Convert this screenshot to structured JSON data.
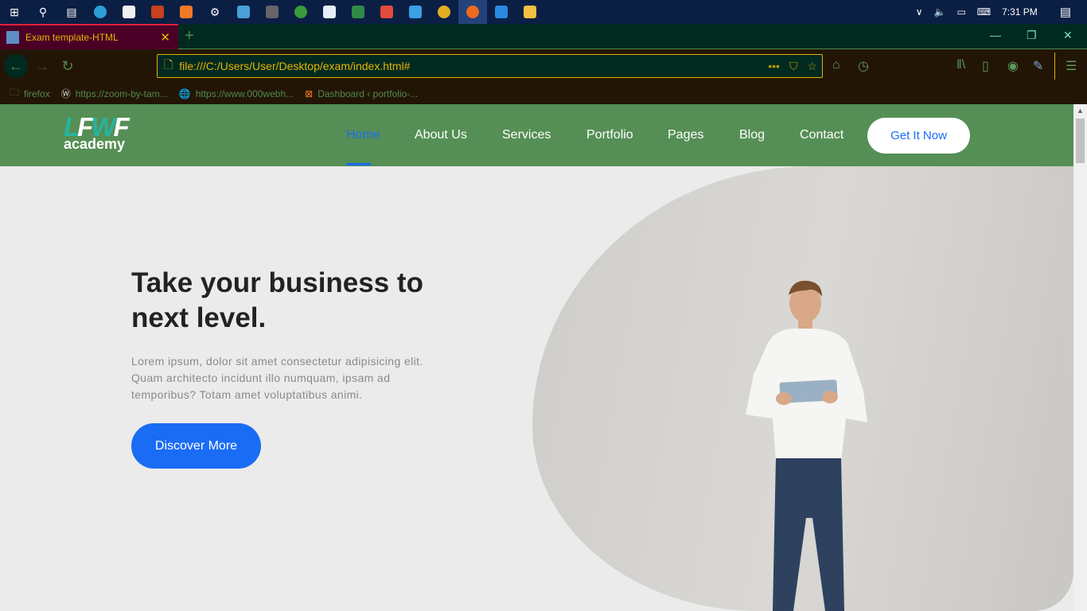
{
  "taskbar": {
    "time": "7:31 PM"
  },
  "browser": {
    "tab_title": "Exam template-HTML",
    "url": "file:///C:/Users/User/Desktop/exam/index.html#",
    "bookmarks": [
      "firefox",
      "https://zoom-by-tam...",
      "https://www.000webh...",
      "Dashboard ‹ portfolio-..."
    ]
  },
  "site": {
    "logo": {
      "text": "LFWF",
      "sub": "academy"
    },
    "menu": [
      "Home",
      "About Us",
      "Services",
      "Portfolio",
      "Pages",
      "Blog",
      "Contact"
    ],
    "cta": "Get It Now",
    "hero": {
      "title": "Take your business to next level.",
      "text": "Lorem ipsum, dolor sit amet consectetur adipisicing elit. Quam architecto incidunt illo numquam, ipsam ad temporibus? Totam amet voluptatibus animi.",
      "button": "Discover More"
    }
  },
  "colors": {
    "nav": "#558f55",
    "accent": "#1a6cf5",
    "hero_bg": "#ebebeb"
  }
}
